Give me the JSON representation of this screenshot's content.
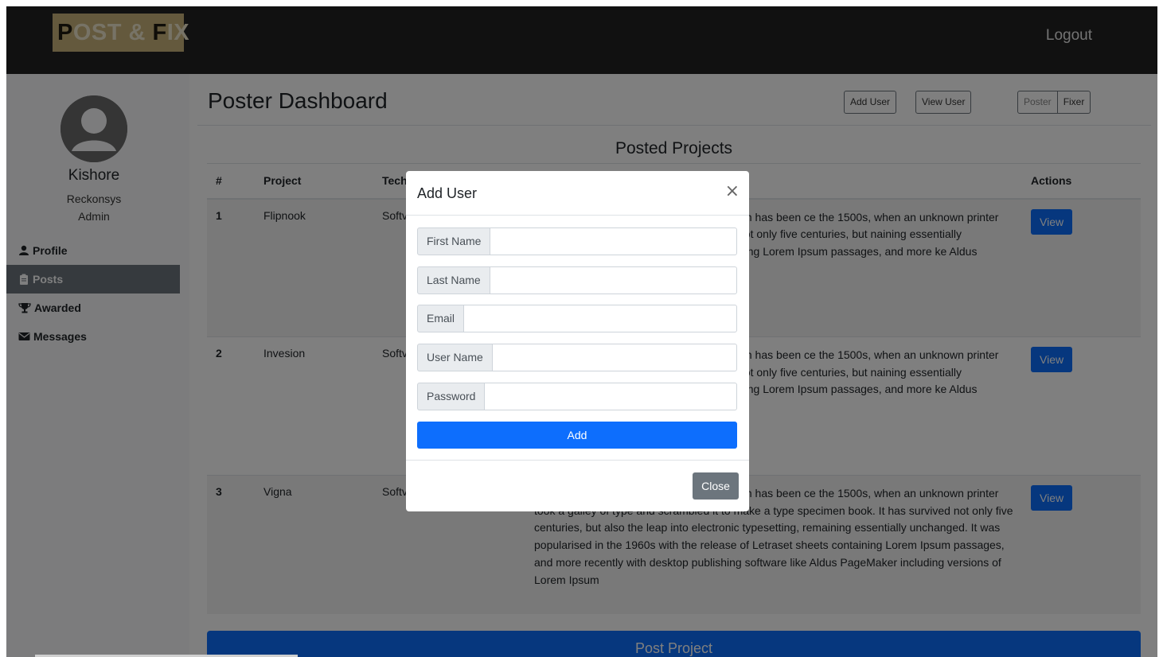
{
  "header": {
    "logo": {
      "parts": [
        {
          "text": "P",
          "tone": "dark"
        },
        {
          "text": "OST & ",
          "tone": "light"
        },
        {
          "text": "F",
          "tone": "dark"
        },
        {
          "text": "IX",
          "tone": "light"
        }
      ]
    },
    "logout_label": "Logout"
  },
  "sidebar": {
    "user_name": "Kishore",
    "company": "Reckonsys",
    "role": "Admin",
    "items": [
      {
        "label": "Profile",
        "icon": "user-icon",
        "active": false
      },
      {
        "label": "Posts",
        "icon": "clipboard-icon",
        "active": true
      },
      {
        "label": "Awarded",
        "icon": "trophy-icon",
        "active": false
      },
      {
        "label": "Messages",
        "icon": "envelope-icon",
        "active": false
      }
    ]
  },
  "main": {
    "title": "Poster Dashboard",
    "add_user_label": "Add User",
    "view_user_label": "View User",
    "toggle": {
      "poster_label": "Poster",
      "fixer_label": "Fixer"
    },
    "section_title": "Posted Projects",
    "table": {
      "headers": {
        "num": "#",
        "project": "Project",
        "tech": "Tech",
        "actions": "Actions"
      },
      "rows": [
        {
          "num": "1",
          "project": "Flipnook",
          "tech": "Softv",
          "view_label": "View",
          "description": "inting and typesetting industry. Lorem Ipsum has been ce the 1500s, when an unknown printer took a galley cimen book. It has survived not only five centuries, but naining essentially unchanged. It was popularised in s containing Lorem Ipsum passages, and more ke Aldus PageMaker including versions of Lorem"
        },
        {
          "num": "2",
          "project": "Invesion",
          "tech": "Softv",
          "view_label": "View",
          "description": "inting and typesetting industry. Lorem Ipsum has been ce the 1500s, when an unknown printer took a galley cimen book. It has survived not only five centuries, but naining essentially unchanged. It was popularised in s containing Lorem Ipsum passages, and more ke Aldus PageMaker including versions of Lorem"
        },
        {
          "num": "3",
          "project": "Vigna",
          "tech": "Softv",
          "view_label": "View",
          "description": "inting and typesetting industry. Lorem Ipsum has been ce the 1500s, when an unknown printer took a galley of type and scrambled it to make a type specimen book. It has survived not only five centuries, but also the leap into electronic typesetting, remaining essentially unchanged. It was popularised in the 1960s with the release of Letraset sheets containing Lorem Ipsum passages, and more recently with desktop publishing software like Aldus PageMaker including versions of Lorem Ipsum"
        }
      ]
    },
    "post_project_label": "Post Project"
  },
  "modal": {
    "title": "Add User",
    "close_x": "×",
    "fields": [
      {
        "label": "First Name",
        "value": ""
      },
      {
        "label": "Last Name",
        "value": ""
      },
      {
        "label": "Email",
        "value": ""
      },
      {
        "label": "User Name",
        "value": ""
      },
      {
        "label": "Password",
        "value": ""
      }
    ],
    "add_label": "Add",
    "close_label": "Close"
  },
  "colors": {
    "topbar": "#222222",
    "logo_bg": "#c9b37a",
    "primary": "#0d6efd",
    "secondary": "#6c757d"
  }
}
